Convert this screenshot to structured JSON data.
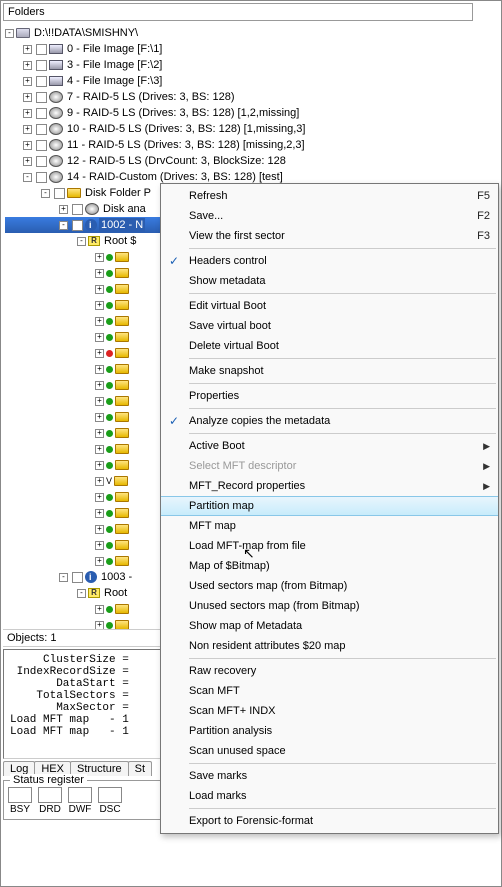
{
  "folders_label": "Folders",
  "root_path": "D:\\!!DATA\\SMISHNY\\",
  "tree": [
    {
      "label": "0 - File Image [F:\\1]",
      "ico": "diskf"
    },
    {
      "label": "3 - File Image [F:\\2]",
      "ico": "diskf"
    },
    {
      "label": "4 - File Image [F:\\3]",
      "ico": "diskf"
    },
    {
      "label": "7 - RAID-5 LS (Drives: 3, BS: 128)",
      "ico": "disk"
    },
    {
      "label": "9 - RAID-5 LS (Drives: 3, BS: 128) [1,2,missing]",
      "ico": "disk"
    },
    {
      "label": "10 - RAID-5 LS (Drives: 3, BS: 128) [1,missing,3]",
      "ico": "disk"
    },
    {
      "label": "11 - RAID-5 LS (Drives: 3, BS: 128) [missing,2,3]",
      "ico": "disk"
    },
    {
      "label": "12 - RAID-5 LS (DrvCount: 3, BlockSize: 128",
      "ico": "disk"
    },
    {
      "label": "14 - RAID-Custom (Drives: 3, BS: 128) [test]",
      "ico": "disk"
    }
  ],
  "disk_folder_label": "Disk Folder P",
  "disk_ana_label": "Disk ana",
  "selected_node": "1002 - N",
  "root_badges": [
    {
      "id": 1,
      "label": "Root $"
    },
    {
      "id": 2,
      "label": "Root"
    }
  ],
  "node_1003": "1003 -",
  "green_count_a": 20,
  "red_index_a": 6,
  "white_index_a": 14,
  "green_count_b": 4,
  "objects_line": "Objects: 1",
  "mono": [
    "     ClusterSize =",
    " IndexRecordSize =",
    "       DataStart =",
    "    TotalSectors =",
    "       MaxSector =",
    "Load MFT map   - 1",
    "Load MFT map   - 1"
  ],
  "tabs": [
    "Log",
    "HEX",
    "Structure",
    "St"
  ],
  "status_register_label": "Status register",
  "status_cells": [
    "BSY",
    "DRD",
    "DWF",
    "DSC"
  ],
  "context_menu": [
    {
      "t": "item",
      "label": "Refresh",
      "shortcut": "F5"
    },
    {
      "t": "item",
      "label": "Save...",
      "shortcut": "F2"
    },
    {
      "t": "item",
      "label": "View the first sector",
      "shortcut": "F3"
    },
    {
      "t": "sep"
    },
    {
      "t": "item",
      "label": "Headers control",
      "checked": true
    },
    {
      "t": "item",
      "label": "Show metadata"
    },
    {
      "t": "sep"
    },
    {
      "t": "item",
      "label": "Edit virtual Boot"
    },
    {
      "t": "item",
      "label": "Save virtual boot"
    },
    {
      "t": "item",
      "label": "Delete virtual Boot"
    },
    {
      "t": "sep"
    },
    {
      "t": "item",
      "label": "Make snapshot"
    },
    {
      "t": "sep"
    },
    {
      "t": "item",
      "label": "Properties"
    },
    {
      "t": "sep"
    },
    {
      "t": "item",
      "label": "Analyze copies the metadata",
      "checked": true
    },
    {
      "t": "sep"
    },
    {
      "t": "item",
      "label": "Active Boot",
      "submenu": true
    },
    {
      "t": "item",
      "label": "Select MFT descriptor",
      "submenu": true,
      "disabled": true
    },
    {
      "t": "item",
      "label": "MFT_Record properties",
      "submenu": true
    },
    {
      "t": "item",
      "label": "Partition map",
      "hover": true
    },
    {
      "t": "item",
      "label": "MFT map"
    },
    {
      "t": "item",
      "label": "Load MFT-map from file"
    },
    {
      "t": "item",
      "label": "Map of $Bitmap)"
    },
    {
      "t": "item",
      "label": "Used sectors map (from Bitmap)"
    },
    {
      "t": "item",
      "label": "Unused sectors map (from Bitmap)"
    },
    {
      "t": "item",
      "label": "Show map of Metadata"
    },
    {
      "t": "item",
      "label": "Non resident attributes $20 map"
    },
    {
      "t": "sep"
    },
    {
      "t": "item",
      "label": "Raw recovery"
    },
    {
      "t": "item",
      "label": "Scan MFT"
    },
    {
      "t": "item",
      "label": "Scan MFT+ INDX"
    },
    {
      "t": "item",
      "label": "Partition analysis"
    },
    {
      "t": "item",
      "label": "Scan unused space"
    },
    {
      "t": "sep"
    },
    {
      "t": "item",
      "label": "Save marks"
    },
    {
      "t": "item",
      "label": "Load marks"
    },
    {
      "t": "sep"
    },
    {
      "t": "item",
      "label": "Export to Forensic-format"
    }
  ]
}
